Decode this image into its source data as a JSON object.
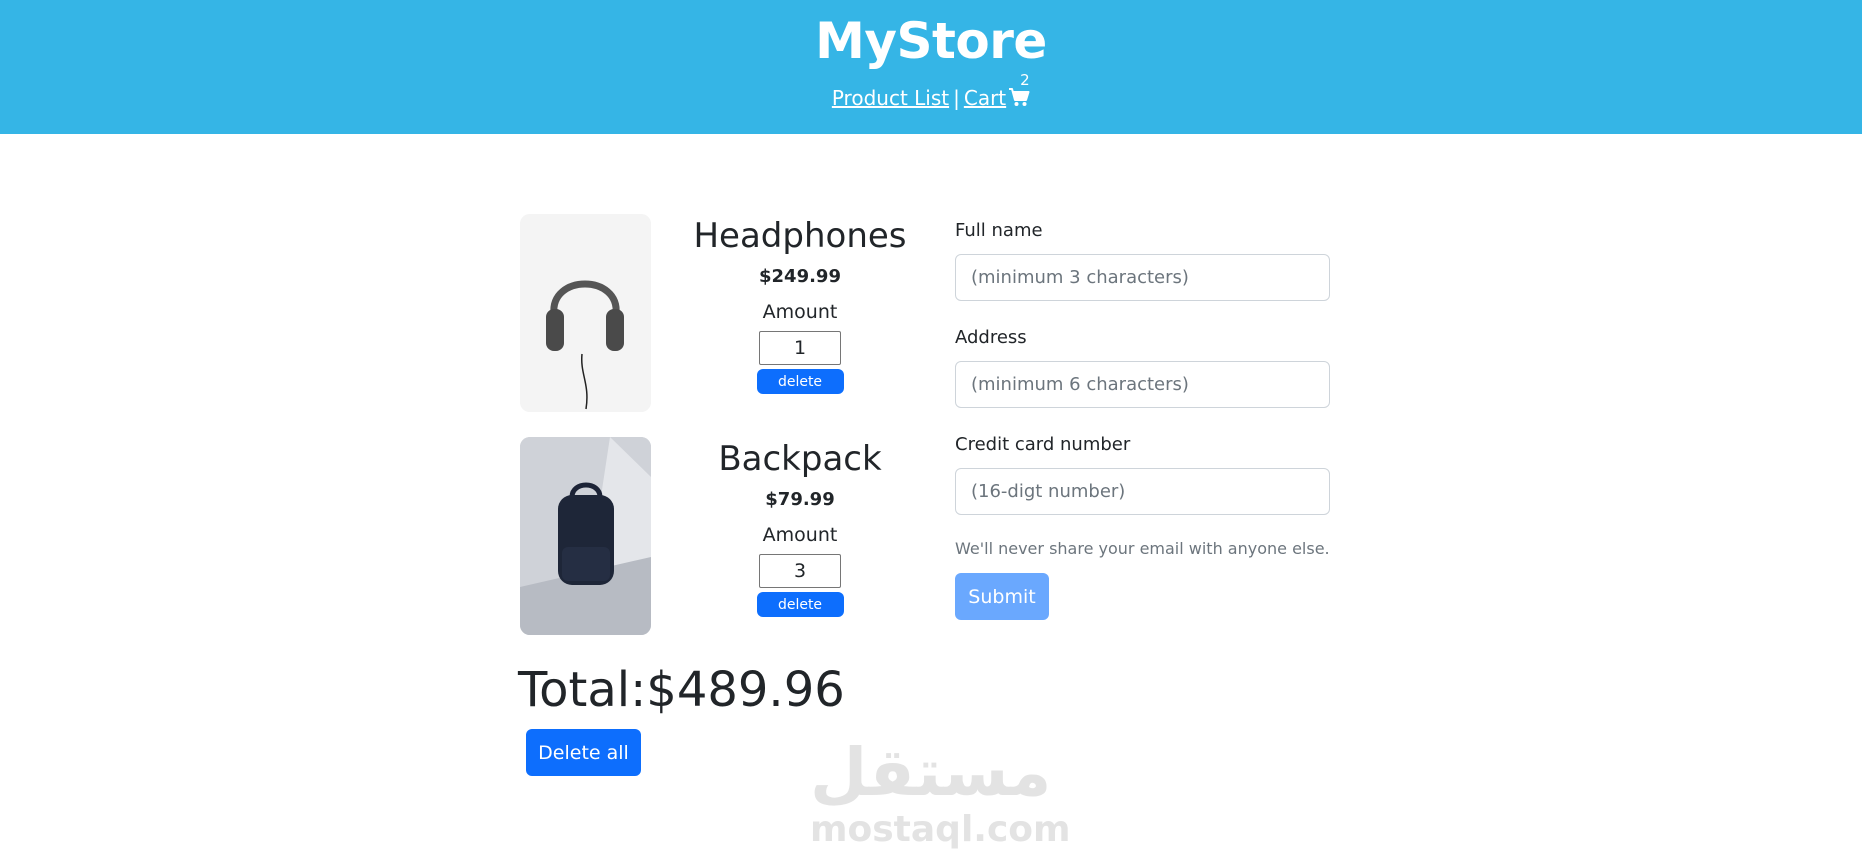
{
  "header": {
    "brand": "MyStore",
    "nav": {
      "product_list": "Product List",
      "separator": "|",
      "cart": "Cart",
      "cart_count": "2",
      "cart_icon": "shopping-cart-icon"
    },
    "background_color": "#35b5e6"
  },
  "cart": {
    "items": [
      {
        "name": "Headphones",
        "price": "$249.99",
        "amount_label": "Amount",
        "amount": "1",
        "delete_label": "delete",
        "image": "headphones-image"
      },
      {
        "name": "Backpack",
        "price": "$79.99",
        "amount_label": "Amount",
        "amount": "3",
        "delete_label": "delete",
        "image": "backpack-image"
      }
    ],
    "total": "Total:$489.96",
    "delete_all_label": "Delete all"
  },
  "form": {
    "full_name": {
      "label": "Full name",
      "placeholder": "(minimum 3 characters)"
    },
    "address": {
      "label": "Address",
      "placeholder": "(minimum 6 characters)"
    },
    "credit_card": {
      "label": "Credit card number",
      "placeholder": "(16-digt number)"
    },
    "help_text": "We'll never share your email with anyone else.",
    "submit_label": "Submit"
  },
  "watermark": {
    "arabic": "مستقل",
    "latin": "mostaql.com"
  },
  "colors": {
    "primary": "#0d6efd",
    "primary_disabled": "#6aa8fe"
  }
}
